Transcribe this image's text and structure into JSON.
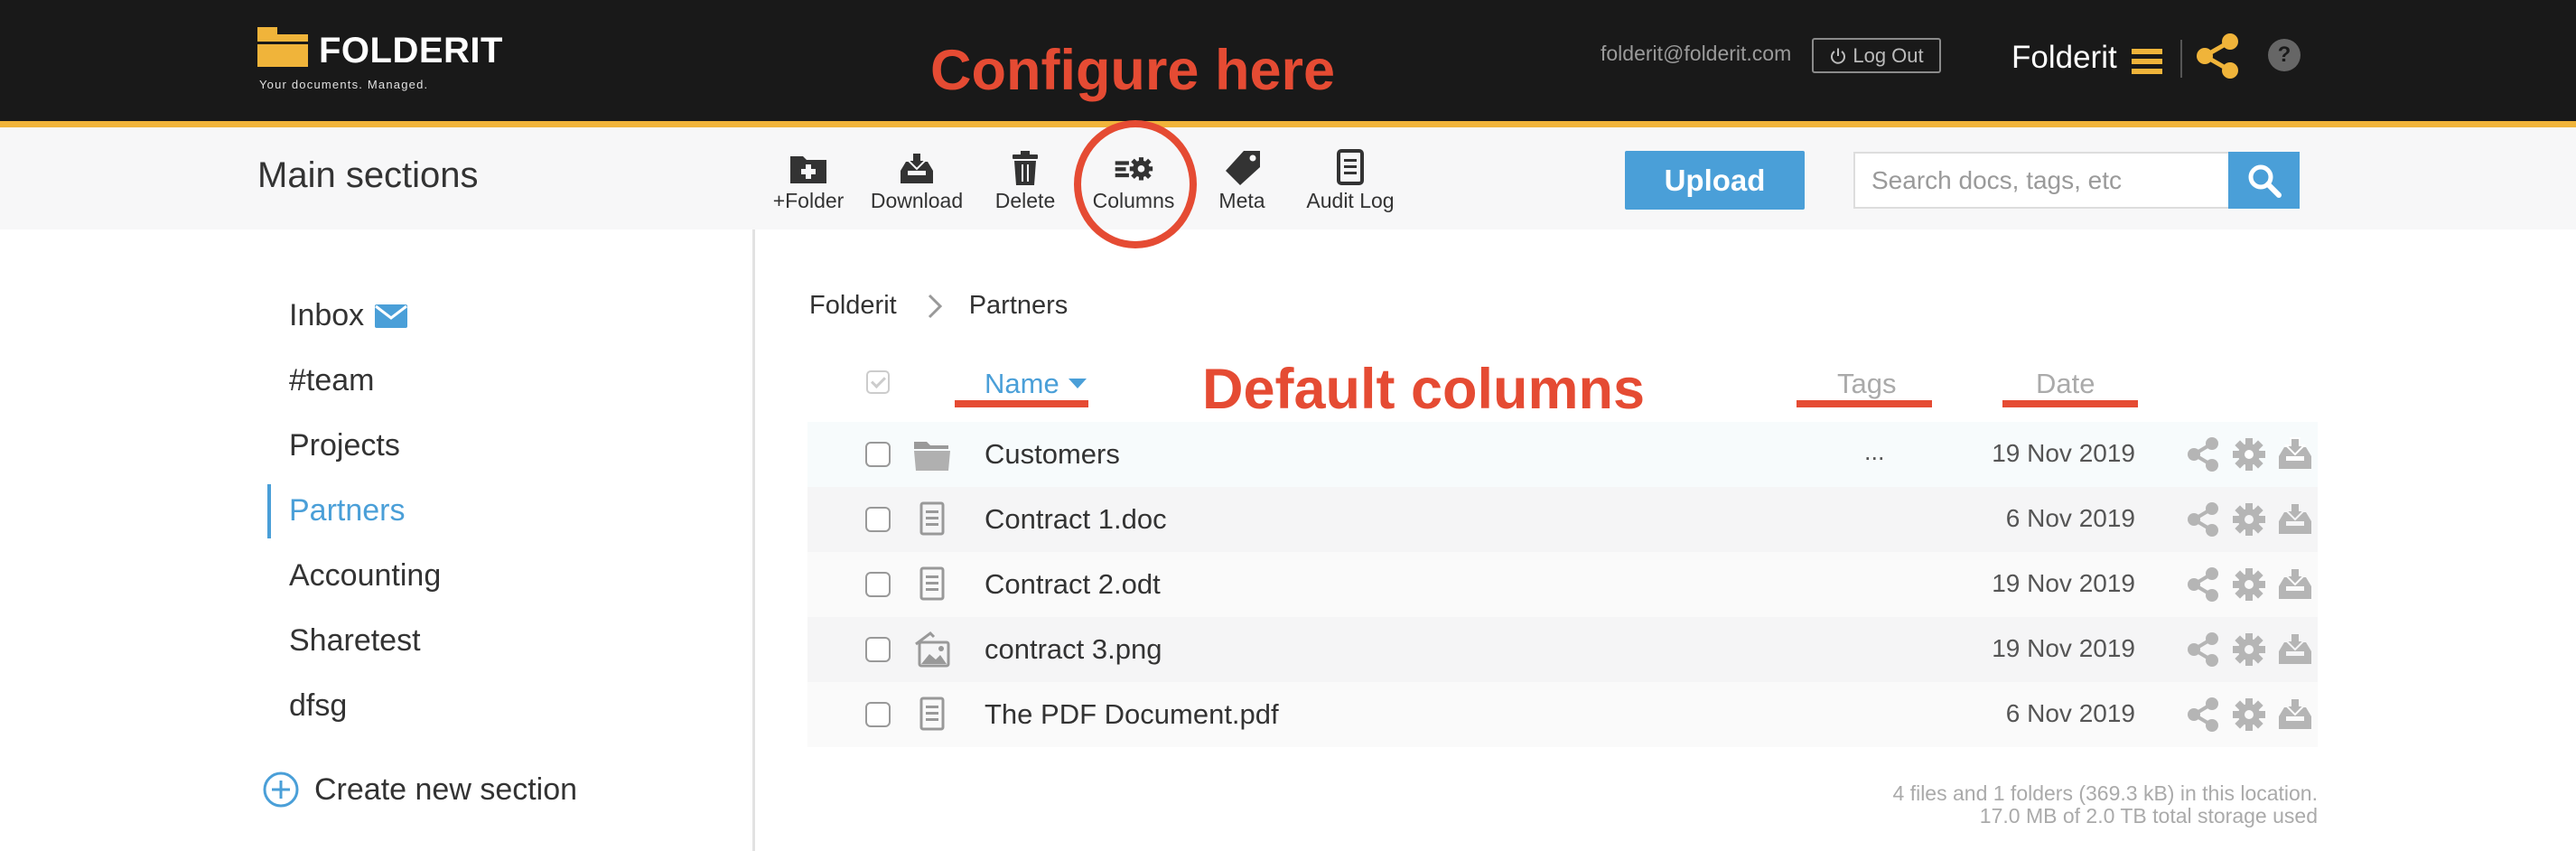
{
  "header": {
    "logo_name": "FOLDERIT",
    "logo_tagline": "Your documents. Managed.",
    "user_email": "folderit@folderit.com",
    "logout_label": "Log Out",
    "account_name": "Folderit",
    "help_label": "?"
  },
  "toolbar": {
    "section_heading": "Main sections",
    "buttons": [
      {
        "label": "+Folder",
        "icon": "folder-plus-icon"
      },
      {
        "label": "Download",
        "icon": "download-tray-icon"
      },
      {
        "label": "Delete",
        "icon": "trash-icon"
      },
      {
        "label": "Columns",
        "icon": "columns-settings-icon"
      },
      {
        "label": "Meta",
        "icon": "tag-icon"
      },
      {
        "label": "Audit Log",
        "icon": "clipboard-icon"
      }
    ],
    "upload_label": "Upload",
    "search_placeholder": "Search docs, tags, etc"
  },
  "annotations": {
    "configure": "Configure here",
    "default_columns": "Default columns"
  },
  "sidebar": {
    "items": [
      {
        "label": "Inbox",
        "icon": "envelope-icon"
      },
      {
        "label": "#team"
      },
      {
        "label": "Projects"
      },
      {
        "label": "Partners",
        "active": true
      },
      {
        "label": "Accounting"
      },
      {
        "label": "Sharetest"
      },
      {
        "label": "dfsg"
      }
    ],
    "create_label": "Create new section"
  },
  "breadcrumb": [
    "Folderit",
    "Partners"
  ],
  "table": {
    "columns": {
      "name": "Name",
      "tags": "Tags",
      "date": "Date"
    },
    "sort": {
      "column": "Name",
      "direction": "descending"
    },
    "rows": [
      {
        "name": "Customers",
        "type": "folder",
        "tags": "...",
        "date": "19 Nov 2019"
      },
      {
        "name": "Contract 1.doc",
        "type": "document",
        "tags": "",
        "date": "6 Nov 2019"
      },
      {
        "name": "Contract 2.odt",
        "type": "document",
        "tags": "",
        "date": "19 Nov 2019"
      },
      {
        "name": "contract 3.png",
        "type": "image",
        "tags": "",
        "date": "19 Nov 2019"
      },
      {
        "name": "The PDF Document.pdf",
        "type": "document",
        "tags": "",
        "date": "6 Nov 2019"
      }
    ]
  },
  "footer": {
    "line1": "4 files and 1 folders (369.3 kB) in this location.",
    "line2": "17.0 MB of 2.0 TB total storage used"
  },
  "colors": {
    "topbar": "#191919",
    "accent": "#f0b43a",
    "primary": "#4a9fd8",
    "annotation": "#e54b33"
  }
}
